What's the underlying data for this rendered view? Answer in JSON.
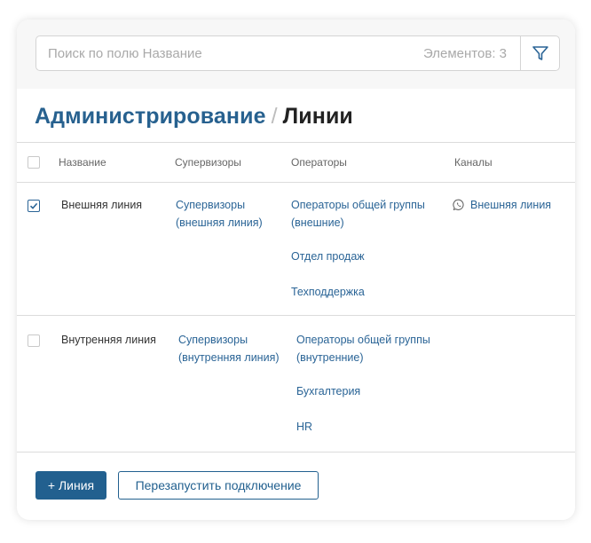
{
  "search": {
    "placeholder": "Поиск по полю Название",
    "count_label": "Элементов: 3"
  },
  "breadcrumb": {
    "parent": "Администрирование",
    "separator": "/",
    "current": "Линии"
  },
  "table": {
    "headers": {
      "name": "Название",
      "supervisors": "Супервизоры",
      "operators": "Операторы",
      "channels": "Каналы"
    },
    "rows": [
      {
        "checked": true,
        "name": "Внешняя линия",
        "supervisors": [
          "Супервизоры",
          "(внешняя линия)"
        ],
        "operator_group": [
          "Операторы общей группы",
          "(внешние)"
        ],
        "operators_extra": [
          "Отдел продаж",
          "Техподдержка"
        ],
        "channel": {
          "icon": "whatsapp-icon",
          "label": "Внешняя линия"
        }
      },
      {
        "checked": false,
        "name": "Внутренняя линия",
        "supervisors": [
          "Супервизоры",
          "(внутренняя линия)"
        ],
        "operator_group": [
          "Операторы общей группы",
          "(внутренние)"
        ],
        "operators_extra": [
          "Бухгалтерия",
          "HR"
        ]
      }
    ]
  },
  "actions": {
    "add_line": "+ Линия",
    "restart": "Перезапустить подключение"
  },
  "colors": {
    "accent": "#22608f",
    "link": "#2a6496",
    "border": "#dcdcdc"
  }
}
